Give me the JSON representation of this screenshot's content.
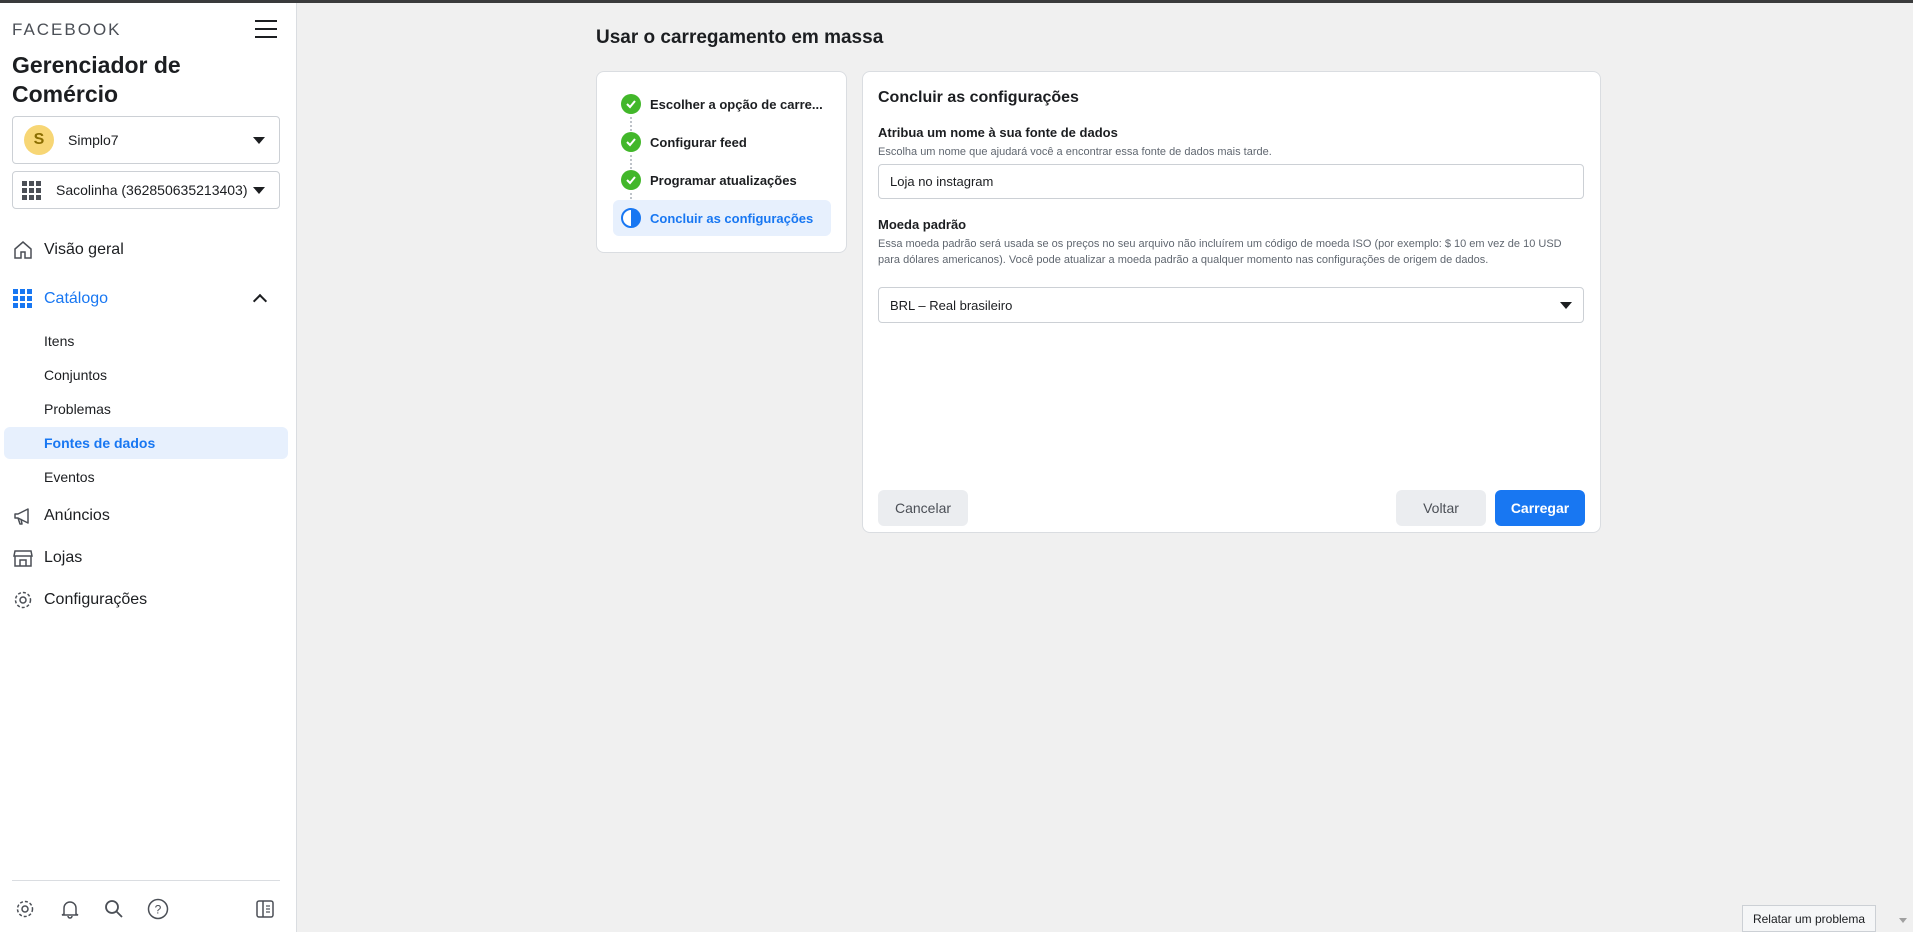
{
  "sidebar": {
    "brand": "FACEBOOK",
    "app_title": "Gerenciador de Comércio",
    "account": {
      "initial": "S",
      "name": "Simplo7"
    },
    "catalog": {
      "name": "Sacolinha (362850635213403)"
    },
    "nav": {
      "overview": "Visão geral",
      "catalog": "Catálogo",
      "catalog_items": [
        "Itens",
        "Conjuntos",
        "Problemas",
        "Fontes de dados",
        "Eventos"
      ],
      "ads": "Anúncios",
      "stores": "Lojas",
      "settings": "Configurações"
    },
    "selected_item": "Fontes de dados",
    "bottom_icons": [
      "gear-icon",
      "bell-icon",
      "search-icon",
      "help-icon",
      "panel-toggle-icon"
    ]
  },
  "main": {
    "page_title": "Usar o carregamento em massa",
    "steps": [
      {
        "label": "Escolher a opção de carre...",
        "status": "done"
      },
      {
        "label": "Configurar feed",
        "status": "done"
      },
      {
        "label": "Programar atualizações",
        "status": "done"
      },
      {
        "label": "Concluir as configurações",
        "status": "current"
      }
    ],
    "form": {
      "title": "Concluir as configurações",
      "name_label": "Atribua um nome à sua fonte de dados",
      "name_help": "Escolha um nome que ajudará você a encontrar essa fonte de dados mais tarde.",
      "name_value": "Loja no instagram",
      "currency_label": "Moeda padrão",
      "currency_help": "Essa moeda padrão será usada se os preços no seu arquivo não incluírem um código de moeda ISO (por exemplo: $ 10 em vez de 10 USD para dólares americanos). Você pode atualizar a moeda padrão a qualquer momento nas configurações de origem de dados.",
      "currency_value": "BRL – Real brasileiro",
      "cancel": "Cancelar",
      "back": "Voltar",
      "upload": "Carregar"
    }
  },
  "footer": {
    "report": "Relatar um problema"
  },
  "colors": {
    "accent": "#1877f2",
    "success": "#42b72a",
    "selected_bg": "#e7f0fd"
  }
}
